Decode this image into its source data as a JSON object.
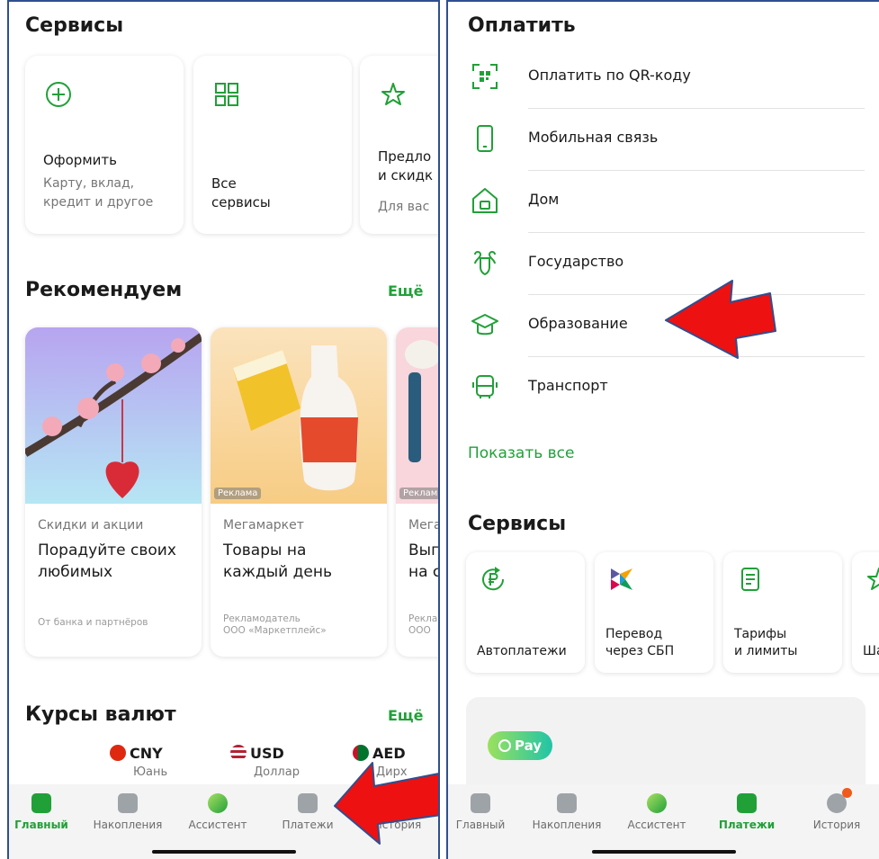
{
  "left": {
    "services_title": "Сервисы",
    "service_cards": [
      {
        "title": "Оформить",
        "sub": "Карту, вклад,\nкредит и другое",
        "icon": "plus-circle-icon"
      },
      {
        "title": "Все\nсервисы",
        "sub": "",
        "icon": "grid-icon"
      },
      {
        "title": "Предло\nи скидк",
        "sub": "Для вас",
        "icon": "star-sparkle-icon"
      }
    ],
    "recommend_title": "Рекомендуем",
    "recommend_more": "Ещё",
    "recommend_cards": [
      {
        "category": "Скидки и акции",
        "title": "Порадуйте своих\nлюбимых",
        "footer": "От банка и партнёров",
        "ad_tag": ""
      },
      {
        "category": "Мегамаркет",
        "title": "Товары на\nкаждый день",
        "footer": "Рекламодатель\nООО «Маркетплейс»",
        "ad_tag": "Реклама"
      },
      {
        "category": "Мега",
        "title": "Выг\nна с",
        "footer": "Рекла\nООО",
        "ad_tag": "Реклам"
      }
    ],
    "rates_title": "Курсы валют",
    "rates_more": "Ещё",
    "currencies": [
      {
        "code": "CNY",
        "name": "Юань"
      },
      {
        "code": "USD",
        "name": "Доллар"
      },
      {
        "code": "AED",
        "name": "Дирх"
      }
    ]
  },
  "right": {
    "pay_title": "Оплатить",
    "pay_items": [
      {
        "label": "Оплатить по QR-коду",
        "icon": "qr-scan-icon"
      },
      {
        "label": "Мобильная связь",
        "icon": "mobile-phone-icon"
      },
      {
        "label": "Дом",
        "icon": "house-icon"
      },
      {
        "label": "Государство",
        "icon": "coat-of-arms-icon"
      },
      {
        "label": "Образование",
        "icon": "graduation-cap-icon"
      },
      {
        "label": "Транспорт",
        "icon": "bus-icon"
      }
    ],
    "show_all": "Показать все",
    "services_title": "Сервисы",
    "service_cards": [
      {
        "title": "Автоплатежи",
        "icon": "autopay-ruble-icon"
      },
      {
        "title": "Перевод\nчерез СБП",
        "icon": "sbp-logo-icon"
      },
      {
        "title": "Тарифы\nи лимиты",
        "icon": "document-list-icon"
      },
      {
        "title": "Ша",
        "icon": "star-icon"
      }
    ],
    "pay_pill": "Pay"
  },
  "nav": {
    "items": [
      "Главный",
      "Накопления",
      "Ассистент",
      "Платежи",
      "История"
    ]
  },
  "colors": {
    "accent": "#21a038",
    "arrow": "#ee1111",
    "frame": "#2f4f8f"
  }
}
